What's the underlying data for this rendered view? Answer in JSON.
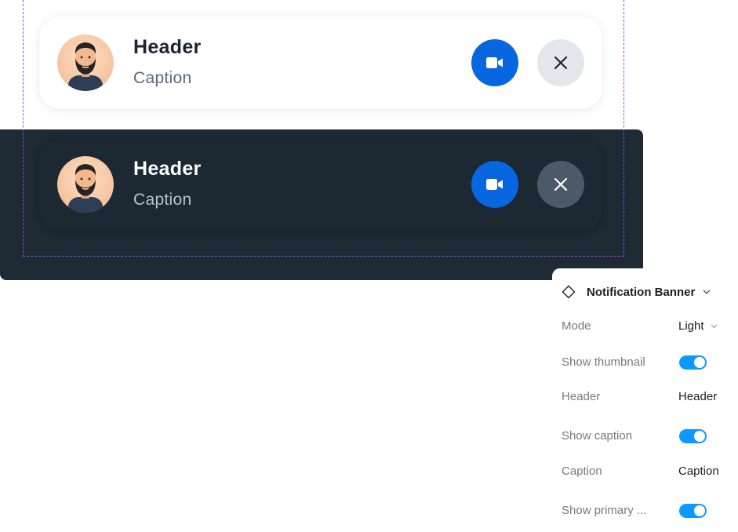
{
  "light_banner": {
    "header": "Header",
    "caption": "Caption"
  },
  "dark_banner": {
    "header": "Header",
    "caption": "Caption"
  },
  "panel": {
    "component_name": "Notification Banner",
    "properties": {
      "mode": {
        "label": "Mode",
        "value": "Light"
      },
      "show_thumbnail": {
        "label": "Show thumbnail",
        "value": true
      },
      "header": {
        "label": "Header",
        "value": "Header"
      },
      "show_caption": {
        "label": "Show caption",
        "value": true
      },
      "caption": {
        "label": "Caption",
        "value": "Caption"
      },
      "show_primary": {
        "label": "Show primary ...",
        "value": true
      }
    }
  },
  "colors": {
    "dark_frame": "#1e2a34",
    "primary_button": "#0866e0",
    "toggle_on": "#0d99ff",
    "selection": "#8a4cf0"
  },
  "icons": {
    "video": "video-camera-icon",
    "close": "close-icon",
    "component": "component-diamond-icon",
    "chevron": "chevron-down-icon"
  }
}
